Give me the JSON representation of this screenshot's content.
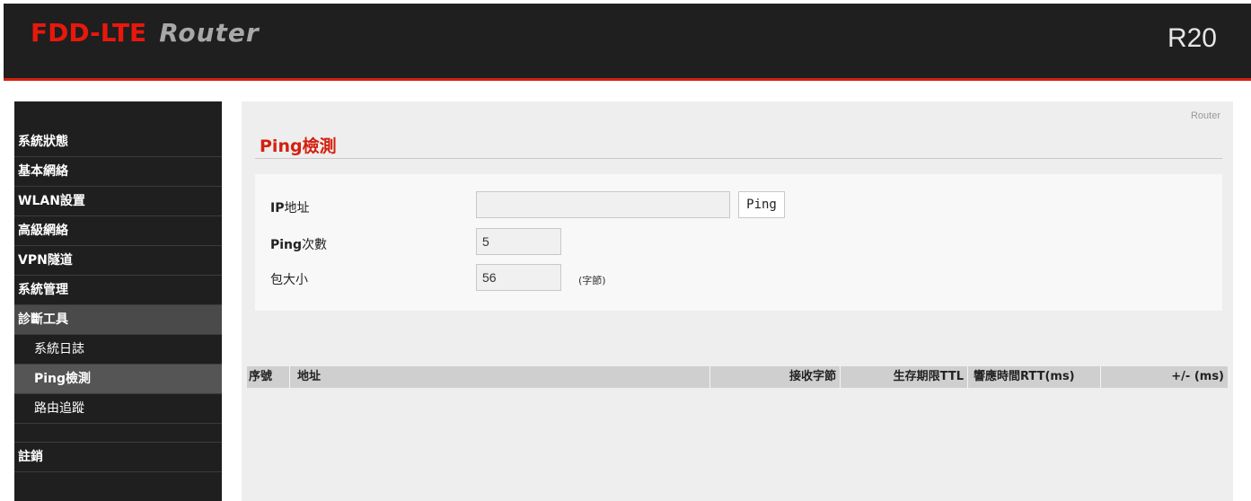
{
  "header": {
    "brand_main": "FDD-LTE",
    "brand_sub": "Router",
    "model": "R20"
  },
  "sidebar": {
    "items": [
      {
        "label": "系統狀態"
      },
      {
        "label": "基本網絡"
      },
      {
        "label": "WLAN設置"
      },
      {
        "label": "高級網絡"
      },
      {
        "label": "VPN隧道"
      },
      {
        "label": "系統管理"
      },
      {
        "label": "診斷工具"
      }
    ],
    "sub_items": [
      {
        "label": "系統日誌"
      },
      {
        "label": "Ping檢測"
      },
      {
        "label": "路由追蹤"
      }
    ],
    "logout": "註銷"
  },
  "content": {
    "breadcrumb": "Router",
    "title": "Ping檢測",
    "form": {
      "ip_label_bold": "IP",
      "ip_label_rest": "地址",
      "ip_value": "",
      "ping_button": "Ping",
      "count_label_bold": "Ping",
      "count_label_rest": "次數",
      "count_value": "5",
      "size_label": "包大小",
      "size_value": "56",
      "size_unit": "(字節)"
    },
    "table": {
      "columns": [
        "序號",
        "地址",
        "接收字節",
        "生存期限TTL",
        "響應時間RTT(ms)",
        "+/- (ms)"
      ]
    }
  }
}
